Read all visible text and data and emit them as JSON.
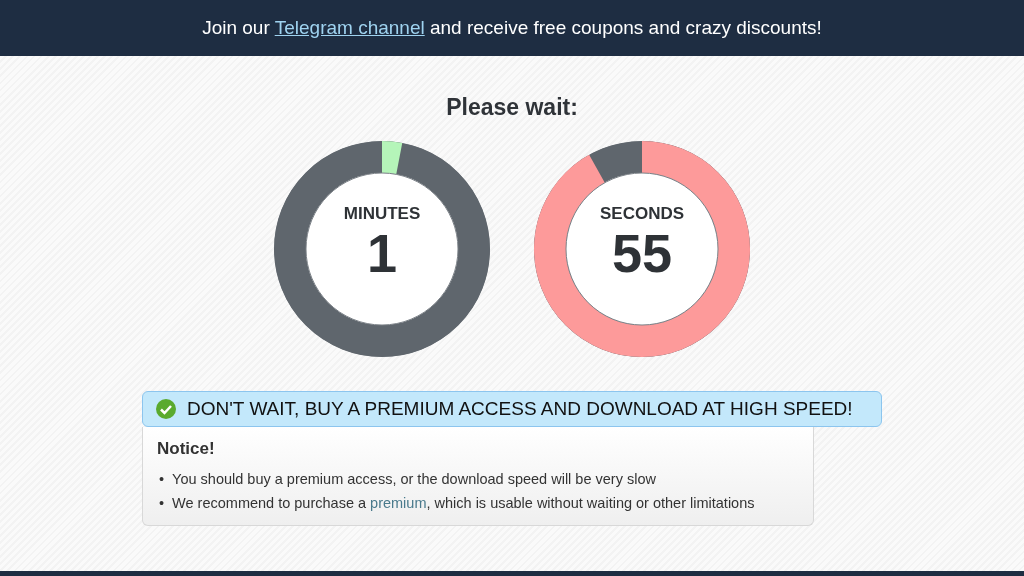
{
  "banner": {
    "before": "Join our ",
    "link": "Telegram channel",
    "after": " and receive free coupons and crazy discounts!"
  },
  "title": "Please wait:",
  "dials": [
    {
      "label": "MINUTES",
      "value": "1",
      "level": 0.03,
      "color": "#b5f5b9"
    },
    {
      "label": "SECONDS",
      "value": "55",
      "level": 0.917,
      "color": "#fd9a9a"
    }
  ],
  "premium_bar": {
    "text": "DON'T WAIT, BUY A PREMIUM ACCESS AND DOWNLOAD AT HIGH SPEED!"
  },
  "notice": {
    "title": "Notice!",
    "items": [
      {
        "bullet": "•",
        "before": "You should buy a premium access, or the download speed will be very slow"
      },
      {
        "bullet": "•",
        "before": "We recommend to purchase a ",
        "link": "premium",
        "after": ", which is usable without waiting or other limitations"
      }
    ]
  }
}
